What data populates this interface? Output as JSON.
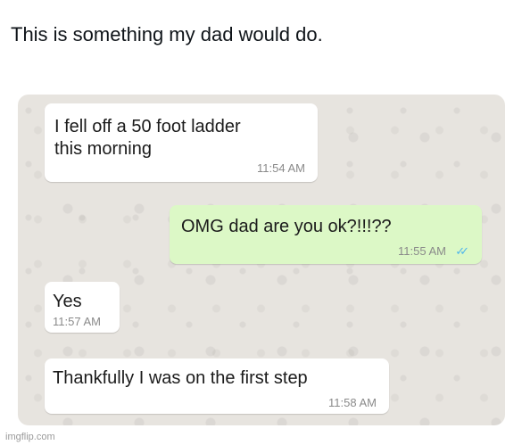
{
  "caption": "This is something my dad would do.",
  "messages": [
    {
      "direction": "incoming",
      "text": "I fell off a 50 foot ladder\nthis morning",
      "time": "11:54 AM"
    },
    {
      "direction": "outgoing",
      "text": "OMG dad are you ok?!!!??",
      "time": "11:55 AM",
      "read": true
    },
    {
      "direction": "incoming",
      "text": "Yes",
      "time": "11:57 AM"
    },
    {
      "direction": "incoming",
      "text": "Thankfully I was on the first step",
      "time": "11:58 AM"
    }
  ],
  "icons": {
    "read_receipt": "double-check-icon"
  },
  "colors": {
    "incoming_bubble": "#ffffff",
    "outgoing_bubble": "#dcf8c6",
    "read_tick": "#4fb6ec",
    "chat_background": "#e7e4df"
  },
  "watermark": "imgflip.com"
}
